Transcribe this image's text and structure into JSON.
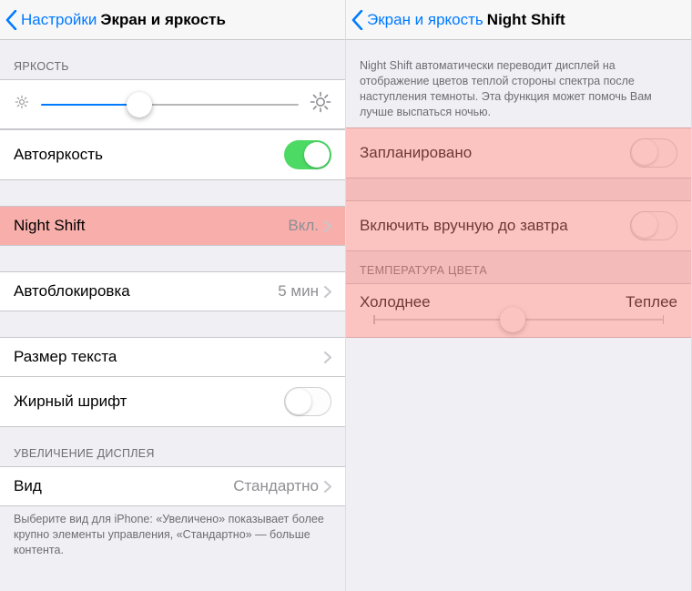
{
  "left": {
    "nav": {
      "back": "Настройки",
      "title": "Экран и яркость"
    },
    "brightness_header": "ЯРКОСТЬ",
    "brightness_slider": {
      "percent": 38
    },
    "auto_brightness": {
      "label": "Автояркость",
      "on": true
    },
    "night_shift": {
      "label": "Night Shift",
      "value": "Вкл."
    },
    "auto_lock": {
      "label": "Автоблокировка",
      "value": "5 мин"
    },
    "text_size": {
      "label": "Размер текста"
    },
    "bold_text": {
      "label": "Жирный шрифт",
      "on": false
    },
    "zoom_header": "УВЕЛИЧЕНИЕ ДИСПЛЕЯ",
    "zoom": {
      "label": "Вид",
      "value": "Стандартно"
    },
    "zoom_footer": "Выберите вид для iPhone: «Увеличено» показывает более крупно элементы управления, «Стандартно» — больше контента."
  },
  "right": {
    "nav": {
      "back": "Экран и яркость",
      "title": "Night Shift"
    },
    "intro": "Night Shift автоматически переводит дисплей на отображение цветов теплой стороны спектра после наступления темноты. Эта функция может помочь Вам лучше выспаться ночью.",
    "scheduled": {
      "label": "Запланировано",
      "on": false
    },
    "manual": {
      "label": "Включить вручную до завтра",
      "on": false
    },
    "temp_header": "ТЕМПЕРАТУРА ЦВЕТА",
    "temp": {
      "cold": "Холоднее",
      "warm": "Теплее",
      "percent": 48
    }
  }
}
